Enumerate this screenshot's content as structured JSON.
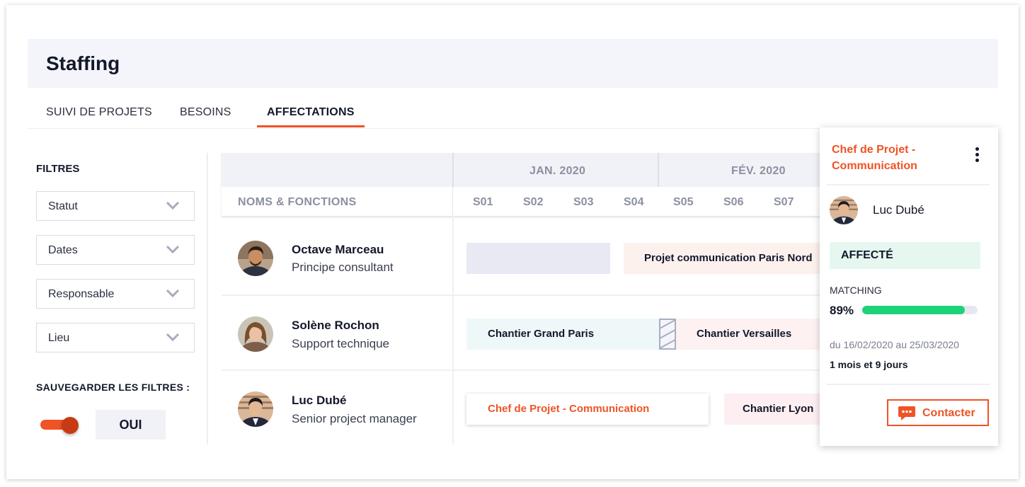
{
  "app": {
    "title": "Staffing"
  },
  "tabs": [
    {
      "label": "SUIVI DE PROJETS",
      "active": false
    },
    {
      "label": "BESOINS",
      "active": false
    },
    {
      "label": "AFFECTATIONS",
      "active": true
    }
  ],
  "filters": {
    "title": "FILTRES",
    "selects": [
      {
        "label": "Statut"
      },
      {
        "label": "Dates"
      },
      {
        "label": "Responsable"
      },
      {
        "label": "Lieu"
      }
    ],
    "save_label": "SAUVEGARDER LES FILTRES :",
    "save_toggle_on": true,
    "save_value": "OUI"
  },
  "grid": {
    "column_header": "NOMS & FONCTIONS",
    "months": [
      "JAN. 2020",
      "FÉV. 2020"
    ],
    "weeks": [
      "S01",
      "S02",
      "S03",
      "S04",
      "S05",
      "S06",
      "S07"
    ],
    "rows": [
      {
        "name": "Octave Marceau",
        "role": "Principe consultant",
        "assignments": [
          {
            "label": ""
          },
          {
            "label": "Projet communication Paris Nord"
          }
        ]
      },
      {
        "name": "Solène Rochon",
        "role": "Support technique",
        "assignments": [
          {
            "label": "Chantier Grand Paris"
          },
          {
            "label": "Chantier Versailles"
          }
        ]
      },
      {
        "name": "Luc Dubé",
        "role": "Senior project manager",
        "assignments": [
          {
            "label": "Chef de Projet - Communication"
          },
          {
            "label": "Chantier Lyon"
          }
        ]
      }
    ]
  },
  "detail_panel": {
    "title": "Chef de Projet - Communication",
    "person": "Luc Dubé",
    "status": "AFFECTÉ",
    "matching_label": "MATCHING",
    "matching_value": "89%",
    "matching_fraction": 0.89,
    "dates": "du 16/02/2020 au 25/03/2020",
    "duration": "1 mois et 9 jours",
    "contact_label": "Contacter"
  },
  "colors": {
    "accent": "#ef5326",
    "success": "#1ed27a",
    "header_bg": "#f4f5fb"
  }
}
